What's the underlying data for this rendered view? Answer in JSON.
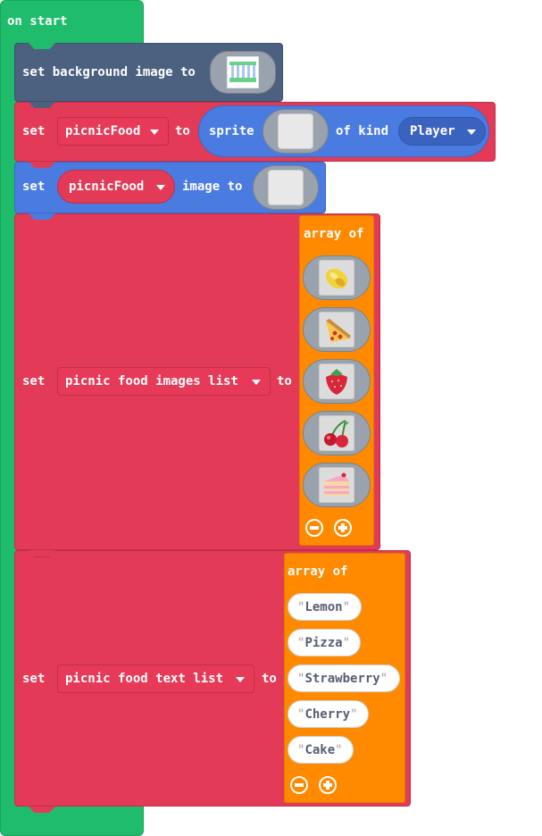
{
  "event": {
    "label": "on start"
  },
  "blocks": {
    "bg": {
      "set": "set background image to",
      "icon": "background-image-thumbnail-icon"
    },
    "sprite": {
      "set": "set",
      "variable": "picnicFood",
      "to": "to",
      "sprite": "sprite",
      "of_kind": "of kind",
      "kind": "Player"
    },
    "image": {
      "set": "set",
      "variable": "picnicFood",
      "image_to": "image to"
    },
    "images_list": {
      "set": "set",
      "variable": "picnic food images list",
      "to": "to",
      "array_of": "array of",
      "items": [
        "lemon-image-icon",
        "pizza-image-icon",
        "strawberry-image-icon",
        "cherry-image-icon",
        "cake-image-icon"
      ]
    },
    "text_list": {
      "set": "set",
      "variable": "picnic food text list",
      "to": "to",
      "array_of": "array of",
      "items": [
        "Lemon",
        "Pizza",
        "Strawberry",
        "Cherry",
        "Cake"
      ]
    }
  },
  "colors": {
    "event": "#1fbd6b",
    "scene": "#4c6080",
    "variables": "#e33b57",
    "sprites": "#4a7be0",
    "arrays": "#ff8a00"
  }
}
